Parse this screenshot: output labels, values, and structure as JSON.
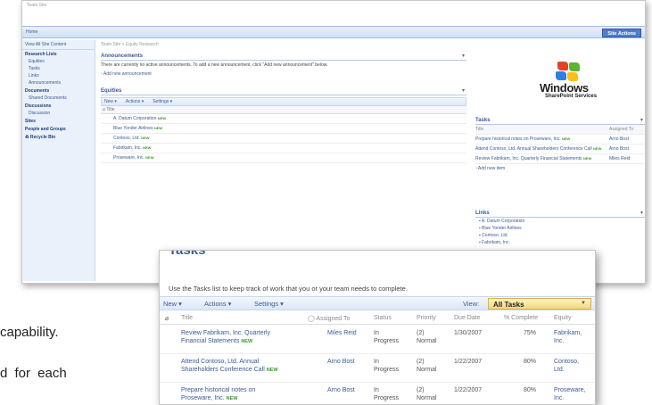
{
  "back": {
    "top_crumb": "Team Site",
    "home_tab": "Home",
    "site_actions": "Site Actions",
    "nav": {
      "view_all": "View All Site Content",
      "sections": [
        {
          "title": "Research Lists",
          "items": [
            "Equities",
            "Tasks",
            "Links",
            "Announcements"
          ]
        },
        {
          "title": "Documents",
          "items": [
            "Shared Documents"
          ]
        },
        {
          "title": "Discussions",
          "items": [
            "Discussion"
          ]
        },
        {
          "title": "Sites",
          "items": []
        },
        {
          "title": "People and Groups",
          "items": []
        }
      ],
      "recycle_bin": "Recycle Bin"
    },
    "breadcrumb": "Team Site > Equity Research",
    "announcements": {
      "title": "Announcements",
      "text": "There are currently no active announcements. To add a new announcement, click \"Add new announcement\" below.",
      "add": "Add new announcement"
    },
    "equities": {
      "title": "Equities",
      "toolbar": [
        "New ▾",
        "Actions ▾",
        "Settings ▾"
      ],
      "col": "Title",
      "rows": [
        "A. Datum Corporation",
        "Blue Yonder Airlines",
        "Contoso, Ltd.",
        "Fabrikam, Inc.",
        "Proseware, Inc."
      ],
      "new_badge": "NEW"
    },
    "logo": {
      "line1": "Windows",
      "line2": "SharePoint Services"
    },
    "tasks": {
      "title": "Tasks",
      "cols": [
        "Title",
        "Assigned To"
      ],
      "rows": [
        {
          "title": "Prepare historical notes on Proseware, Inc.",
          "assigned": "Arno Bost"
        },
        {
          "title": "Attend Contoso, Ltd. Annual Shareholders Conference Call",
          "assigned": "Arno Bost"
        },
        {
          "title": "Review Fabrikam, Inc. Quarterly Financial Statements",
          "assigned": "Miles Reid"
        }
      ],
      "add": "Add new item"
    },
    "links": {
      "title": "Links",
      "rows": [
        "A. Datum Corporation",
        "Blue Yonder Airlines",
        "Contoso, Ltd.",
        "Fabrikam, Inc."
      ]
    }
  },
  "front": {
    "title": "Tasks",
    "description": "Use the Tasks list to keep track of work that you or your team needs to complete.",
    "toolbar": {
      "new": "New ▾",
      "actions": "Actions ▾",
      "settings": "Settings ▾",
      "view_label": "View:",
      "view_value": "All Tasks"
    },
    "headers": [
      "Title",
      "Assigned To",
      "Status",
      "Priority",
      "Due Date",
      "% Complete",
      "Equity"
    ],
    "rows": [
      {
        "title1": "Review Fabrikam, Inc. Quarterly",
        "title2": "Financial Statements",
        "assigned": "Miles Reid",
        "status1": "In",
        "status2": "Progress",
        "priority1": "(2)",
        "priority2": "Normal",
        "due": "1/30/2007",
        "complete": "75%",
        "equity1": "Fabrikam,",
        "equity2": "Inc."
      },
      {
        "title1": "Attend Contoso, Ltd. Annual",
        "title2": "Shareholders Conference Call",
        "assigned": "Arno Bost",
        "status1": "In",
        "status2": "Progress",
        "priority1": "(2)",
        "priority2": "Normal",
        "due": "1/22/2007",
        "complete": "80%",
        "equity1": "Contoso,",
        "equity2": "Ltd."
      },
      {
        "title1": "Prepare historical notes on",
        "title2": "Proseware, Inc.",
        "assigned": "Arno Bost",
        "status1": "In",
        "status2": "Progress",
        "priority1": "(2)",
        "priority2": "Normal",
        "due": "1/22/2007",
        "complete": "80%",
        "equity1": "Proseware,",
        "equity2": "Inc."
      }
    ],
    "new_badge": "NEW"
  },
  "slide": {
    "line1": "capability.",
    "line2": "d  for  each"
  },
  "colors": {
    "link": "#3b5998",
    "new_badge": "#3a9a2a",
    "view_highlight": "#f5d77a",
    "site_actions": "#4f7fc9"
  }
}
